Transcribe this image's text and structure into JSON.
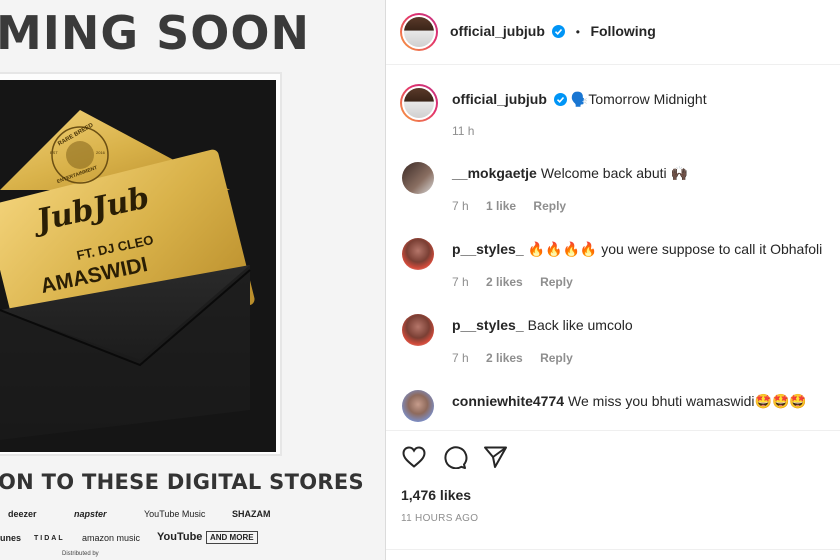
{
  "media": {
    "coming_soon": "MING SOON",
    "artwork": {
      "badge_top": "RARE BREED",
      "badge_bottom": "ENTERTAINMENT",
      "badge_est": "EST",
      "badge_year": "2016",
      "artist": "JubJub",
      "feature": "FT. DJ CLEO",
      "song": "AMASWIDI"
    },
    "stores_title": "ON TO THESE DIGITAL STORES",
    "stores": [
      "deezer",
      "napster",
      "YouTube Music",
      "SHAZAM",
      "unes",
      "TIDAL",
      "amazon music",
      "YouTube",
      "AND MORE"
    ],
    "distributed": "Distributed by"
  },
  "header": {
    "username": "official_jubjub",
    "separator": "•",
    "follow_status": "Following"
  },
  "caption": {
    "username": "official_jubjub",
    "text": "🗣️Tomorrow Midnight",
    "time": "11 h"
  },
  "comments": [
    {
      "username": "__mokgaetje",
      "text": "Welcome back abuti 🙌🏿",
      "time": "7 h",
      "likes": "1 like",
      "reply": "Reply"
    },
    {
      "username": "p__styles_",
      "text": "🔥🔥🔥🔥 you were suppose to call it Obhafoli",
      "time": "7 h",
      "likes": "2 likes",
      "reply": "Reply"
    },
    {
      "username": "p__styles_",
      "text": "Back like umcolo",
      "time": "7 h",
      "likes": "2 likes",
      "reply": "Reply"
    },
    {
      "username": "conniewhite4774",
      "text": "We miss you bhuti wamaswidi🤩🤩🤩"
    }
  ],
  "post": {
    "likes": "1,476 likes",
    "time": "11 HOURS AGO"
  },
  "colors": {
    "verified": "#0095f6",
    "gold": "#d9b24a",
    "secondary_text": "#8e8e8e"
  },
  "icons": [
    "heart-icon",
    "comment-icon",
    "share-icon",
    "verified-badge-icon"
  ]
}
